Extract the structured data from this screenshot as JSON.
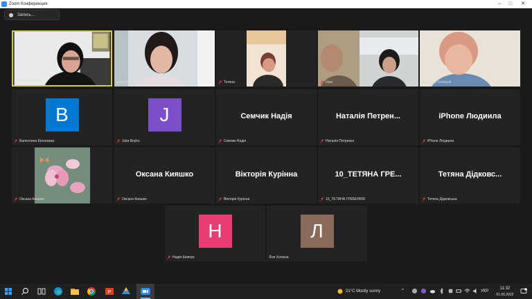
{
  "window": {
    "title": "Zoom Конференция"
  },
  "recording": {
    "label": "Запись..."
  },
  "tiles": [
    {
      "name": "Людмила Бриль",
      "active": true
    },
    {
      "name": "Інна Олександрівна Колесник"
    },
    {
      "name": "Тетяна"
    },
    {
      "name": "User"
    },
    {
      "name": "Evgeniya Goretyuk"
    },
    {
      "name": "Валентина Білоножко",
      "avatar": "B",
      "color": "#0078d4"
    },
    {
      "name": "Julia Boyko",
      "avatar": "J",
      "color": "#7b4fc9"
    },
    {
      "name": "Семчик Надія",
      "title": "Семчик Надія"
    },
    {
      "name": "Наталія Петренко",
      "title": "Наталія  Петрен..."
    },
    {
      "name": "iPhone Людиила",
      "title": "iPhone Людиила"
    },
    {
      "name": "Оксана Кияшко"
    },
    {
      "name": "Оксана Кияшко",
      "title": "Оксана Кияшко"
    },
    {
      "name": "Вікторія Курінна",
      "title": "Вікторія Курінна"
    },
    {
      "name": "10_ТЕТЯНА ГРЕБЕНЮК",
      "title": "10_ТЕТЯНА  ГРЕ..."
    },
    {
      "name": "Тетяна Дідковська",
      "title": "Тетяна Дідковс..."
    },
    {
      "name": "Надія Шевчук",
      "avatar": "H",
      "color": "#e63e73"
    },
    {
      "name": "Лізя Холюза",
      "avatar": "Л",
      "color": "#8a6a5a"
    }
  ],
  "taskbar": {
    "weather": "21°C  Mostly sunny",
    "lang": "УКР",
    "time": "11:32",
    "date": "01.06.2022"
  }
}
